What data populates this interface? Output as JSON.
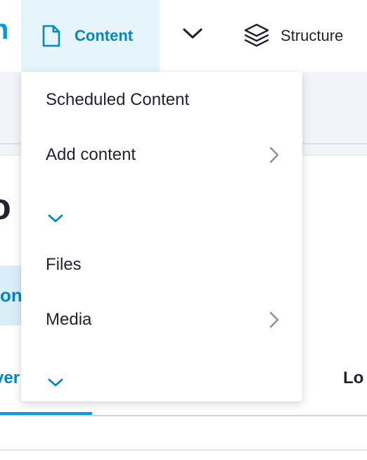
{
  "toolbar": {
    "logo_fragment": "n",
    "content_label": "Content",
    "structure_label": "Structure"
  },
  "page": {
    "title_fragment": "o",
    "button_fragment": "on",
    "tab_overview_fragment": "ver",
    "tab_log_fragment": "Lo"
  },
  "dropdown": {
    "scheduled_content": "Scheduled Content",
    "add_content": "Add content",
    "files": "Files",
    "media": "Media"
  },
  "colors": {
    "accent": "#009cde",
    "accent_text": "#0087c7",
    "active_bg": "#e6f4fb",
    "text": "#222330",
    "chevron_gray": "#8e929c"
  },
  "icons": {
    "content": "file-icon",
    "expand": "chevron-down-icon",
    "structure": "layers-icon",
    "submenu": "chevron-right-icon",
    "toggle": "chevron-down-icon"
  }
}
